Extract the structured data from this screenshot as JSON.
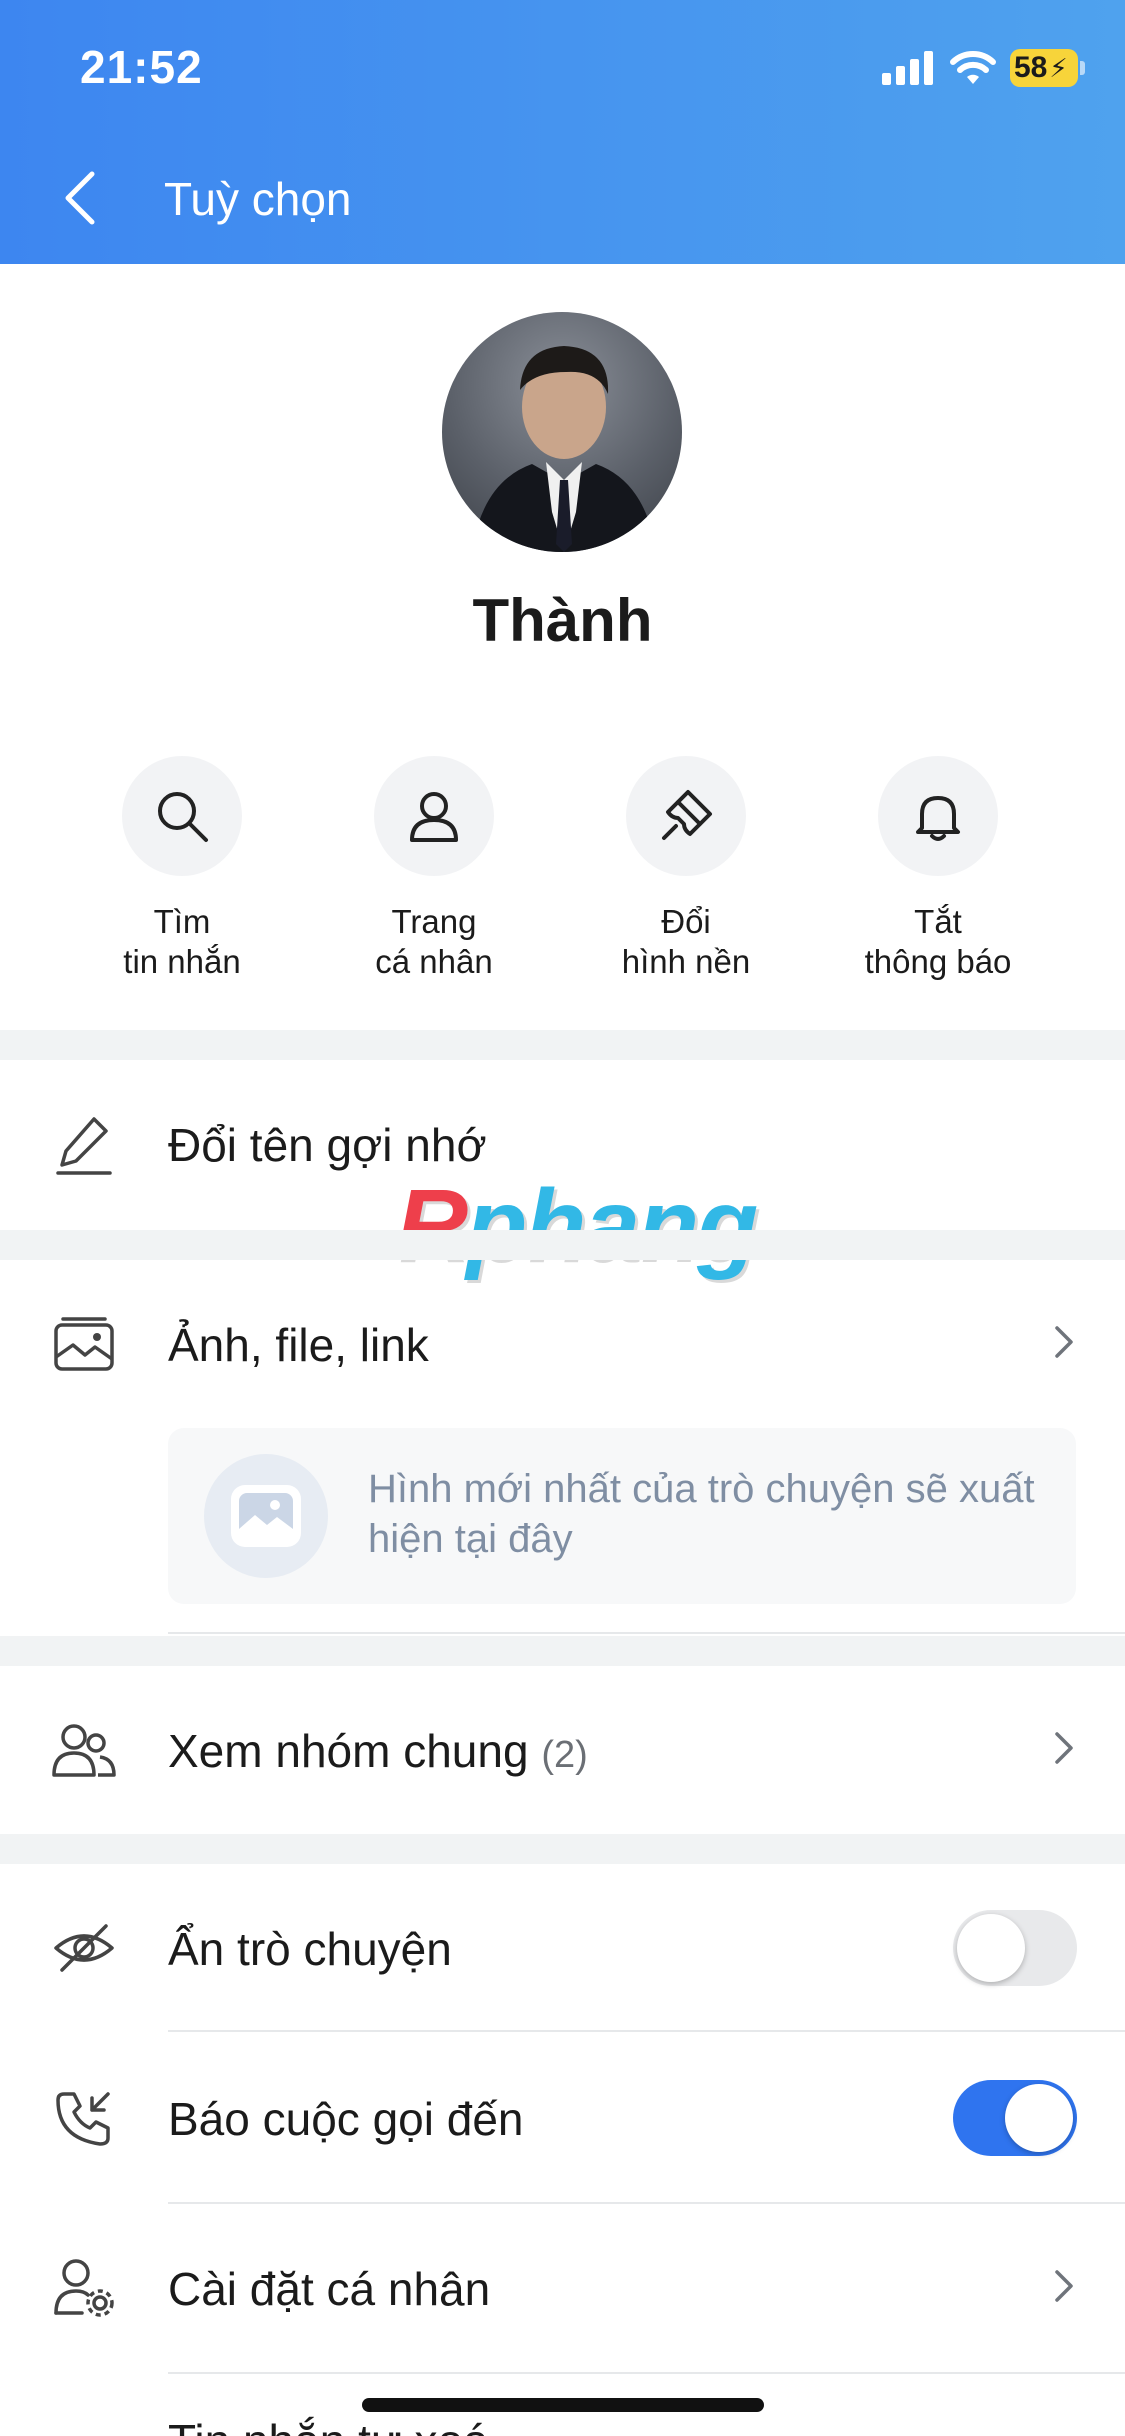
{
  "status_bar": {
    "time": "21:52",
    "battery": "58"
  },
  "header": {
    "title": "Tuỳ chọn"
  },
  "profile": {
    "name": "Thành"
  },
  "actions": [
    {
      "label": "Tìm\ntin nhắn",
      "icon": "search-icon"
    },
    {
      "label": "Trang\ncá nhân",
      "icon": "user-icon"
    },
    {
      "label": "Đổi\nhình nền",
      "icon": "paint-brush-icon"
    },
    {
      "label": "Tắt\nthông báo",
      "icon": "bell-icon"
    }
  ],
  "rename": {
    "label": "Đổi tên gợi nhớ"
  },
  "media": {
    "label": "Ảnh, file, link",
    "placeholder": "Hình mới nhất của trò chuyện sẽ xuất hiện tại đây"
  },
  "groups": {
    "label": "Xem nhóm chung",
    "count": "(2)"
  },
  "hide_chat": {
    "label": "Ẩn trò chuyện",
    "enabled": false
  },
  "call_alert": {
    "label": "Báo cuộc gọi đến",
    "enabled": true
  },
  "personal_settings": {
    "label": "Cài đặt cá nhân"
  },
  "next_item_partial": {
    "label": "Tin nhắn tự xoá"
  },
  "watermark": {
    "first": "R",
    "rest": "phang"
  },
  "colors": {
    "header_start": "#3d86f0",
    "header_end": "#4fa2ee",
    "toggle_on": "#2f74ef",
    "battery": "#f7d43a"
  }
}
